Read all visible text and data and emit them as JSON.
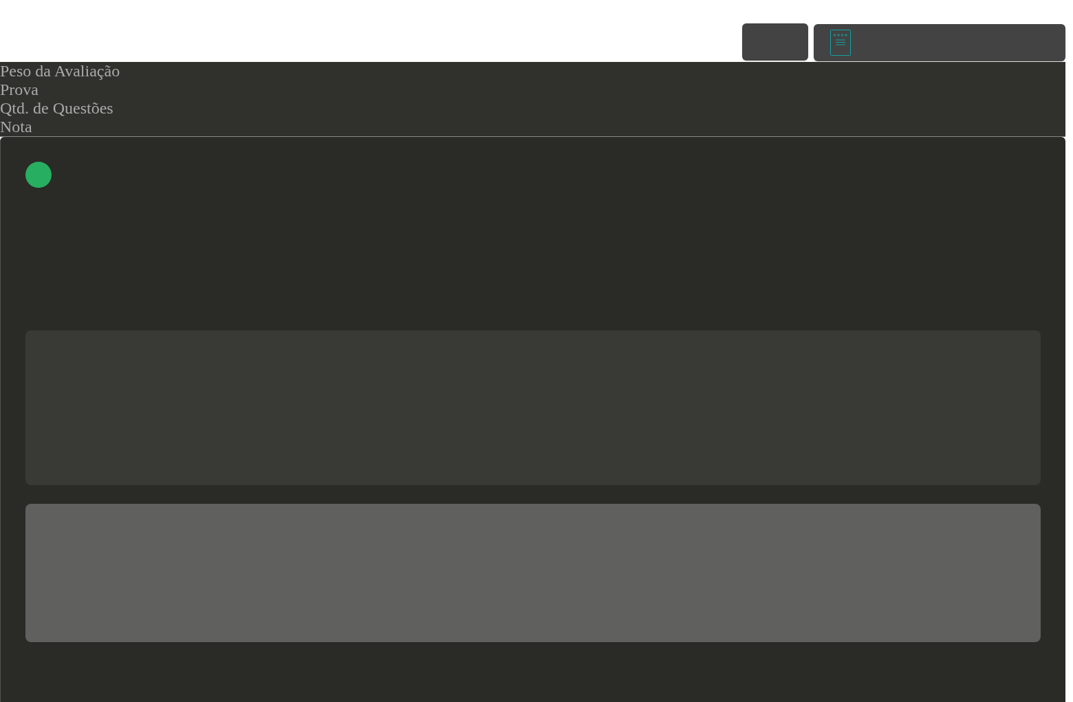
{
  "labels": [
    "Peso da Avaliação",
    "Prova",
    "Qtd. de Questões",
    "Nota"
  ],
  "status": {
    "color": "#27ae60"
  }
}
